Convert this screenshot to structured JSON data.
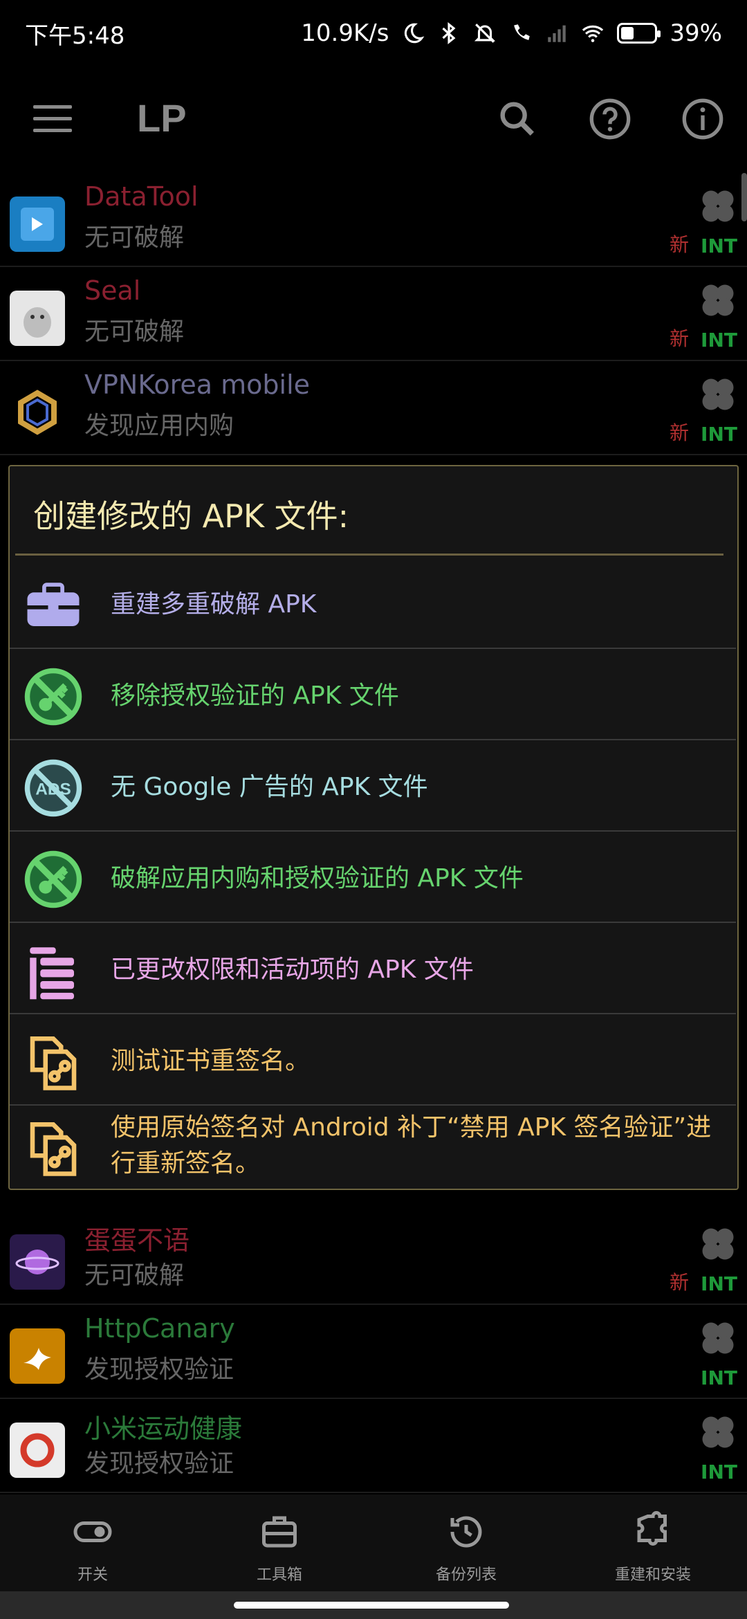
{
  "status_bar": {
    "time": "下午5:48",
    "speed": "10.9K/s",
    "battery": "39%",
    "battery_level": 0.39
  },
  "app_bar": {
    "title": "LP"
  },
  "apps": [
    {
      "name": "DataTool",
      "status": "无可破解",
      "new": "新",
      "int": "INT",
      "name_color": "#8a2030"
    },
    {
      "name": "Seal",
      "status": "无可破解",
      "new": "新",
      "int": "INT",
      "name_color": "#8a2030"
    },
    {
      "name": "VPNKorea mobile",
      "status": "发现应用内购",
      "new": "新",
      "int": "INT",
      "name_color": "#6a6a8e"
    },
    {
      "name": "蛋蛋不语",
      "status": "无可破解",
      "new": "新",
      "int": "INT",
      "name_color": "#8a2030"
    },
    {
      "name": "HttpCanary",
      "status": "发现授权验证",
      "new": "",
      "int": "INT",
      "name_color": "#2b7a3a"
    },
    {
      "name": "小米运动健康",
      "status": "发现授权验证",
      "new": "",
      "int": "INT",
      "name_color": "#2b7a3a"
    }
  ],
  "dialog": {
    "title": "创建修改的 APK 文件:",
    "options": [
      {
        "label": "重建多重破解 APK",
        "color": "#b4aee8",
        "icon": "toolbox-icon"
      },
      {
        "label": "移除授权验证的 APK 文件",
        "color": "#66d36e",
        "icon": "no-key-icon"
      },
      {
        "label": "无 Google 广告的 APK 文件",
        "color": "#a6dde0",
        "icon": "no-ads-icon"
      },
      {
        "label": "破解应用内购和授权验证的 APK 文件",
        "color": "#66d36e",
        "icon": "no-key-icon"
      },
      {
        "label": "已更改权限和活动项的 APK 文件",
        "color": "#e7a6e6",
        "icon": "list-bars-icon"
      },
      {
        "label": "测试证书重签名。",
        "color": "#f3c36a",
        "icon": "sign-files-icon"
      },
      {
        "label": "使用原始签名对 Android 补丁“禁用 APK 签名验证”进行重新签名。",
        "color": "#f3c36a",
        "icon": "sign-files-icon"
      }
    ]
  },
  "bottom_nav": [
    {
      "label": "开关",
      "icon": "toggle-icon"
    },
    {
      "label": "工具箱",
      "icon": "toolbox-icon"
    },
    {
      "label": "备份列表",
      "icon": "backup-icon"
    },
    {
      "label": "重建和安装",
      "icon": "puzzle-icon"
    }
  ]
}
